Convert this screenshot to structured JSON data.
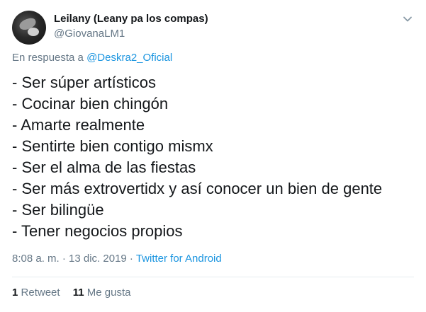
{
  "author": {
    "display_name": "Leilany (Leany pa los compas)",
    "handle": "@GiovanaLM1"
  },
  "reply": {
    "prefix": "En respuesta a ",
    "mention": "@Deskra2_Oficial"
  },
  "tweet": {
    "lines": [
      "- Ser súper artísticos",
      "- Cocinar bien chingón",
      "- Amarte realmente",
      "- Sentirte bien contigo mismx",
      "- Ser el alma de las fiestas",
      "- Ser más extrovertidx y así conocer un bien de gente",
      "- Ser bilingüe",
      "- Tener negocios propios"
    ]
  },
  "meta": {
    "timestamp": "8:08 a. m. · 13 dic. 2019",
    "separator": " · ",
    "source": "Twitter for Android"
  },
  "stats": {
    "retweets_count": "1",
    "retweets_label": "Retweet",
    "likes_count": "11",
    "likes_label": "Me gusta"
  },
  "icons": {
    "menu": "chevron-down-icon"
  },
  "colors": {
    "link": "#1b95e0",
    "secondary_text": "#657786",
    "primary_text": "#14171a",
    "divider": "#e6ecf0"
  }
}
